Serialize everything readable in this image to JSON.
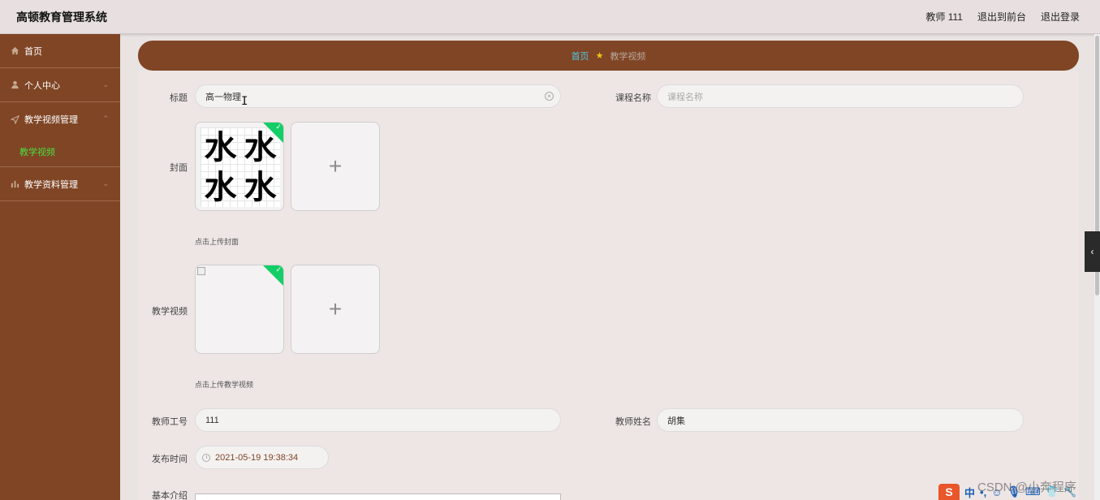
{
  "header": {
    "app_title": "高顿教育管理系统",
    "user_label": "教师 111",
    "front_link": "退出到前台",
    "logout_link": "退出登录"
  },
  "sidebar": {
    "items": [
      {
        "label": "首页",
        "icon": "home-icon"
      },
      {
        "label": "个人中心",
        "icon": "user-icon"
      },
      {
        "label": "教学视频管理",
        "icon": "navigation-icon",
        "children": [
          "教学视频"
        ]
      },
      {
        "label": "教学资料管理",
        "icon": "bar-chart-icon"
      }
    ]
  },
  "breadcrumb": {
    "home": "首页",
    "current": "教学视频"
  },
  "form": {
    "title_label": "标题",
    "title_value": "高一物理",
    "course_label": "课程名称",
    "course_placeholder": "课程名称",
    "cover_label": "封面",
    "cover_hint": "点击上传封面",
    "cover_image_text": [
      "水",
      "水",
      "水",
      "水"
    ],
    "video_label": "教学视频",
    "video_hint": "点击上传教学视频",
    "teacher_id_label": "教师工号",
    "teacher_id_value": "111",
    "teacher_name_label": "教师姓名",
    "teacher_name_value": "胡集",
    "publish_time_label": "发布时间",
    "publish_time_value": "2021-05-19 19:38:34",
    "intro_label": "基本介绍"
  },
  "overlay": {
    "watermark": "CSDN @小奔程序",
    "ime_logo": "S",
    "ime_lang": "中"
  },
  "colors": {
    "sidebar": "#7f4525",
    "accent_green": "#4fdc3d",
    "breadcrumb_home": "#4ec9e6",
    "upload_check": "#13ce66"
  }
}
